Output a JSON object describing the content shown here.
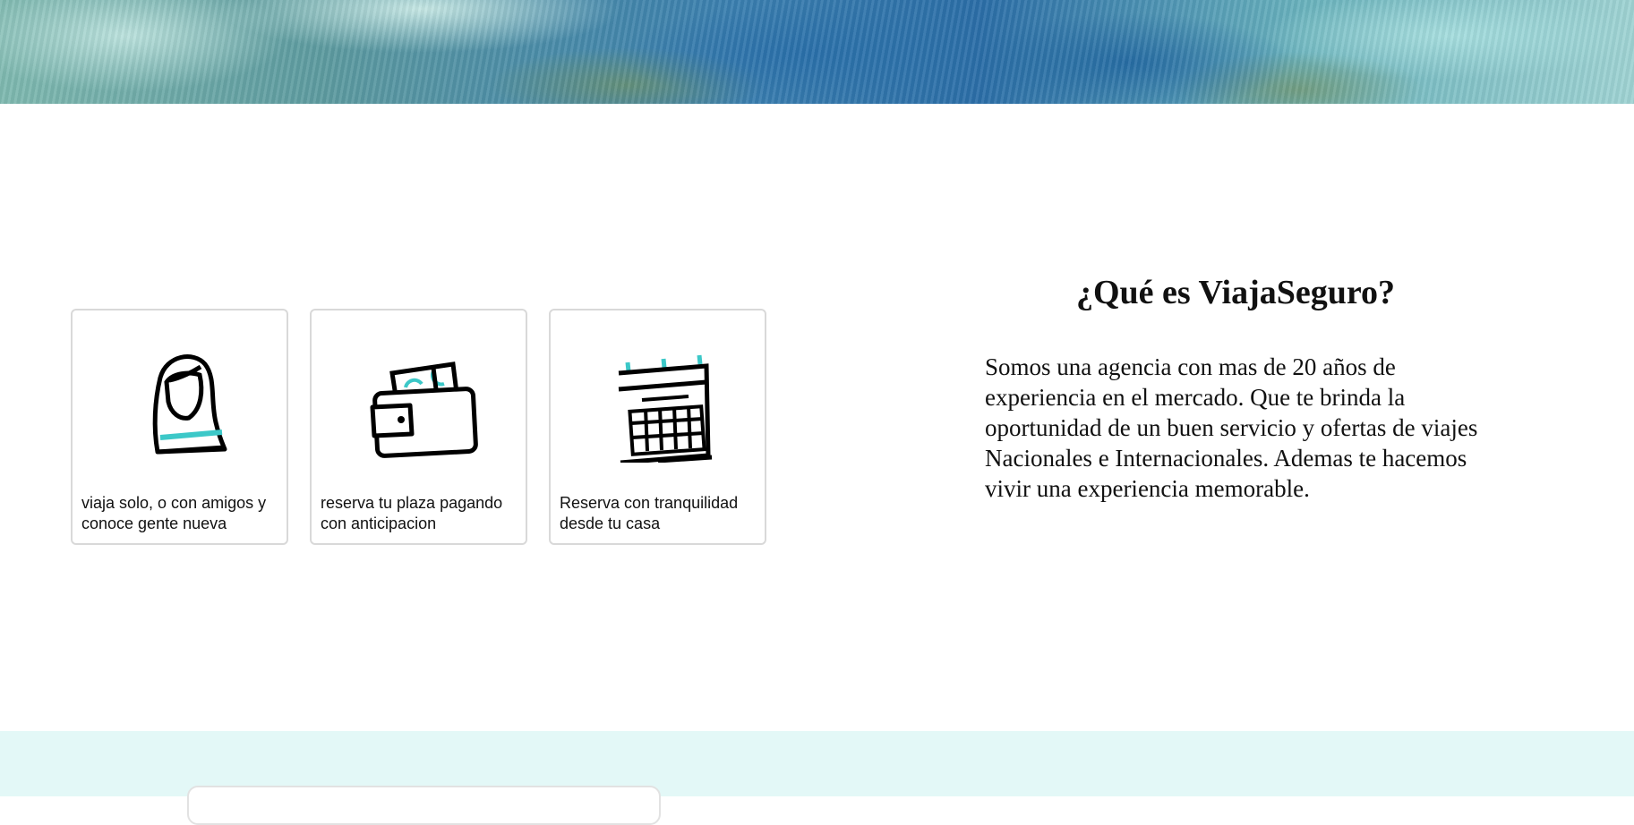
{
  "hero": {
    "icon": "sea-banner-image"
  },
  "features": [
    {
      "icon": "woman-icon",
      "text": "viaja solo, o con amigos y conoce gente nueva"
    },
    {
      "icon": "wallet-icon",
      "text": "reserva tu plaza pagando con anticipacion"
    },
    {
      "icon": "calendar-icon",
      "text": "Reserva con tranquilidad desde tu casa"
    }
  ],
  "about": {
    "title": "¿Qué es ViajaSeguro?",
    "body": "Somos una agencia con mas de 20 años de experiencia en el mercado. Que te brinda la oportunidad de un buen servicio y ofertas de viajes Nacionales e Internacionales. Ademas te hacemos vivir una experiencia memorable."
  },
  "colors": {
    "accent": "#3cc8c8",
    "band": "#e3f8f7",
    "border": "#d9d9d9"
  }
}
